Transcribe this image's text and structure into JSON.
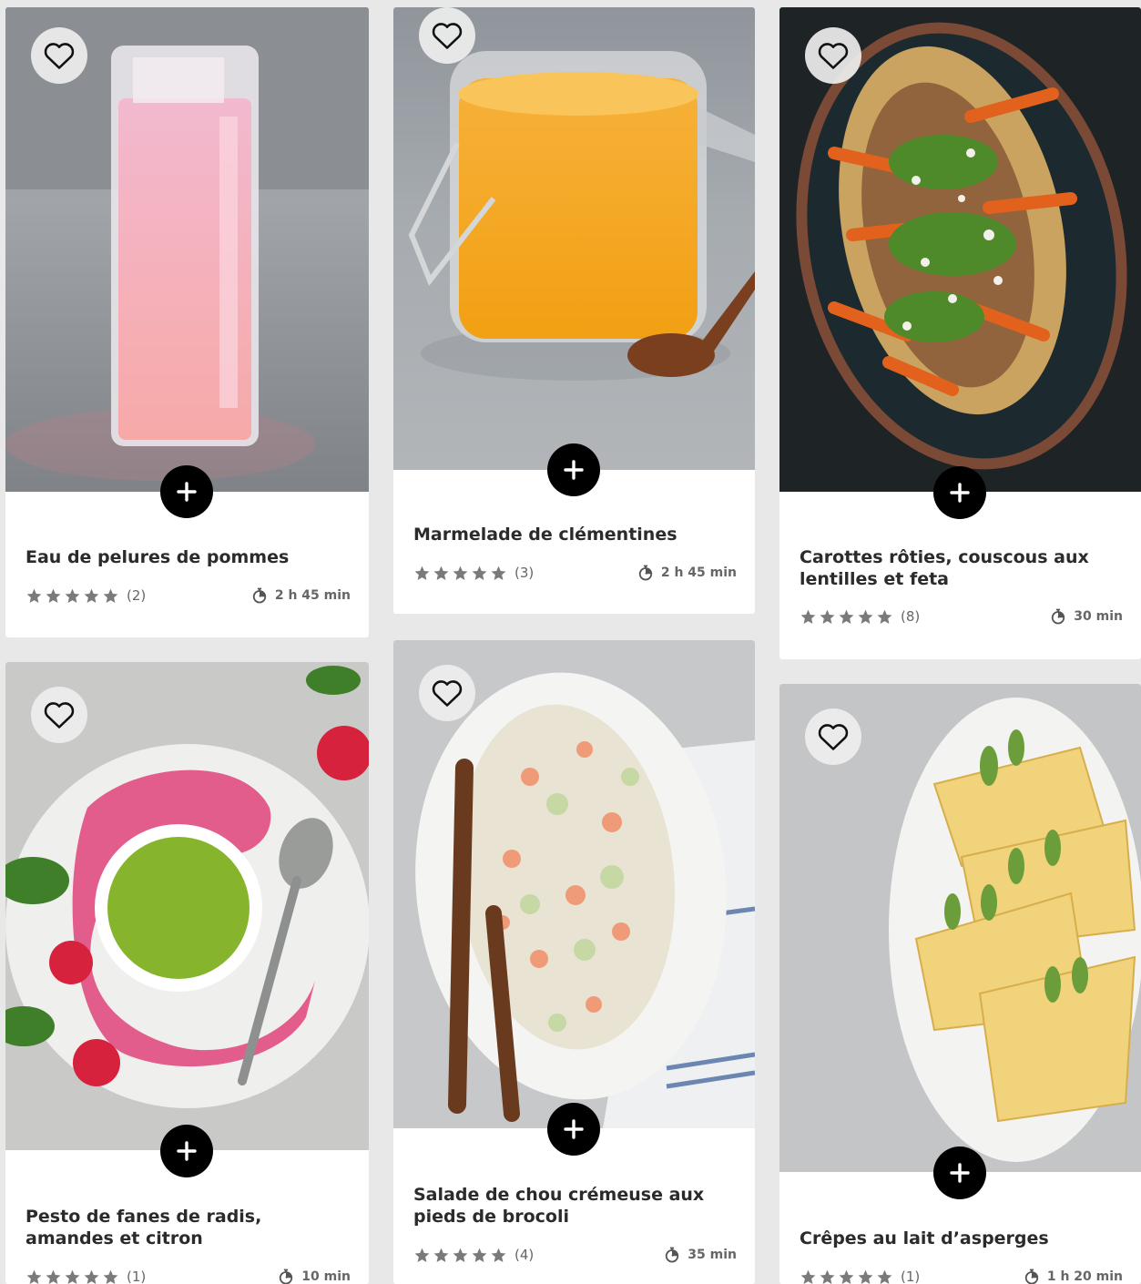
{
  "icons": {
    "favorite": "heart-outline-icon",
    "add": "plus-icon",
    "rating": "star-icon",
    "time": "stopwatch-icon"
  },
  "colors": {
    "star": "#7a7a7a",
    "title": "#2b2b2b",
    "add_button": "#000000"
  },
  "recipes": [
    {
      "title": "Eau de pelures de pommes",
      "rating_count": "(2)",
      "time": "2 h 45 min"
    },
    {
      "title": "Marmelade de clémentines",
      "rating_count": "(3)",
      "time": "2 h 45 min"
    },
    {
      "title": "Carottes rôties, couscous aux lentilles et feta",
      "rating_count": "(8)",
      "time": "30 min"
    },
    {
      "title": "Pesto de fanes de radis, amandes et citron",
      "rating_count": "(1)",
      "time": "10 min"
    },
    {
      "title": "Salade de chou crémeuse aux pieds de brocoli",
      "rating_count": "(4)",
      "time": "35 min"
    },
    {
      "title": "Crêpes au lait d’asperges",
      "rating_count": "(1)",
      "time": "1 h 20 min"
    }
  ]
}
